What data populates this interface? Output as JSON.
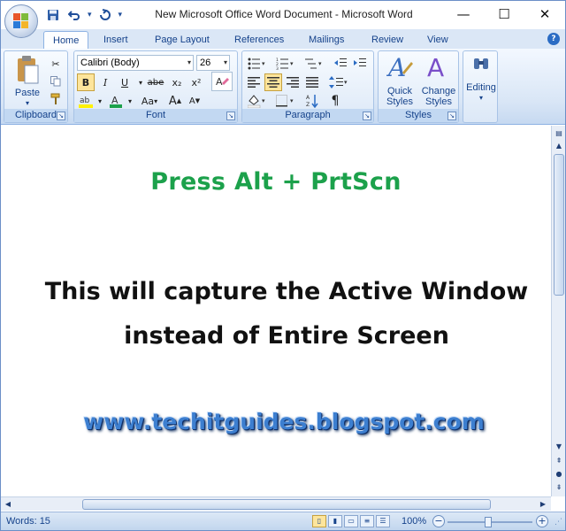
{
  "window": {
    "title": "New Microsoft Office Word Document - Microsoft Word",
    "controls": {
      "minimize": "—",
      "maximize": "☐",
      "close": "✕"
    }
  },
  "qat": {
    "save": "💾",
    "undo": "↶",
    "redo": "↻",
    "more": "▾"
  },
  "tabs": [
    {
      "label": "Home",
      "active": true
    },
    {
      "label": "Insert"
    },
    {
      "label": "Page Layout"
    },
    {
      "label": "References"
    },
    {
      "label": "Mailings"
    },
    {
      "label": "Review"
    },
    {
      "label": "View"
    }
  ],
  "ribbon": {
    "clipboard": {
      "label": "Clipboard",
      "paste": "Paste"
    },
    "font": {
      "label": "Font",
      "face": "Calibri (Body)",
      "size": "26",
      "bold": "B",
      "italic": "I",
      "underline": "U",
      "strike": "abe",
      "subscript": "x₂",
      "superscript": "x²",
      "change_case": "Aa",
      "grow": "A",
      "shrink": "A"
    },
    "paragraph": {
      "label": "Paragraph",
      "show_marks": "¶"
    },
    "styles": {
      "label": "Styles",
      "quick_styles": "Quick Styles",
      "change_styles": "Change Styles"
    },
    "editing": {
      "label": "Editing"
    }
  },
  "document": {
    "line1": "Press  Alt + PrtScn",
    "line2": "This will capture the Active Window",
    "line3": "instead of Entire Screen",
    "url": "www.techitguides.blogspot.com"
  },
  "status": {
    "words": "Words: 15",
    "zoom": "100%"
  },
  "colors": {
    "accent": "#15428b",
    "green_text": "#1ca14b",
    "url_blue": "#3d7fd0"
  }
}
